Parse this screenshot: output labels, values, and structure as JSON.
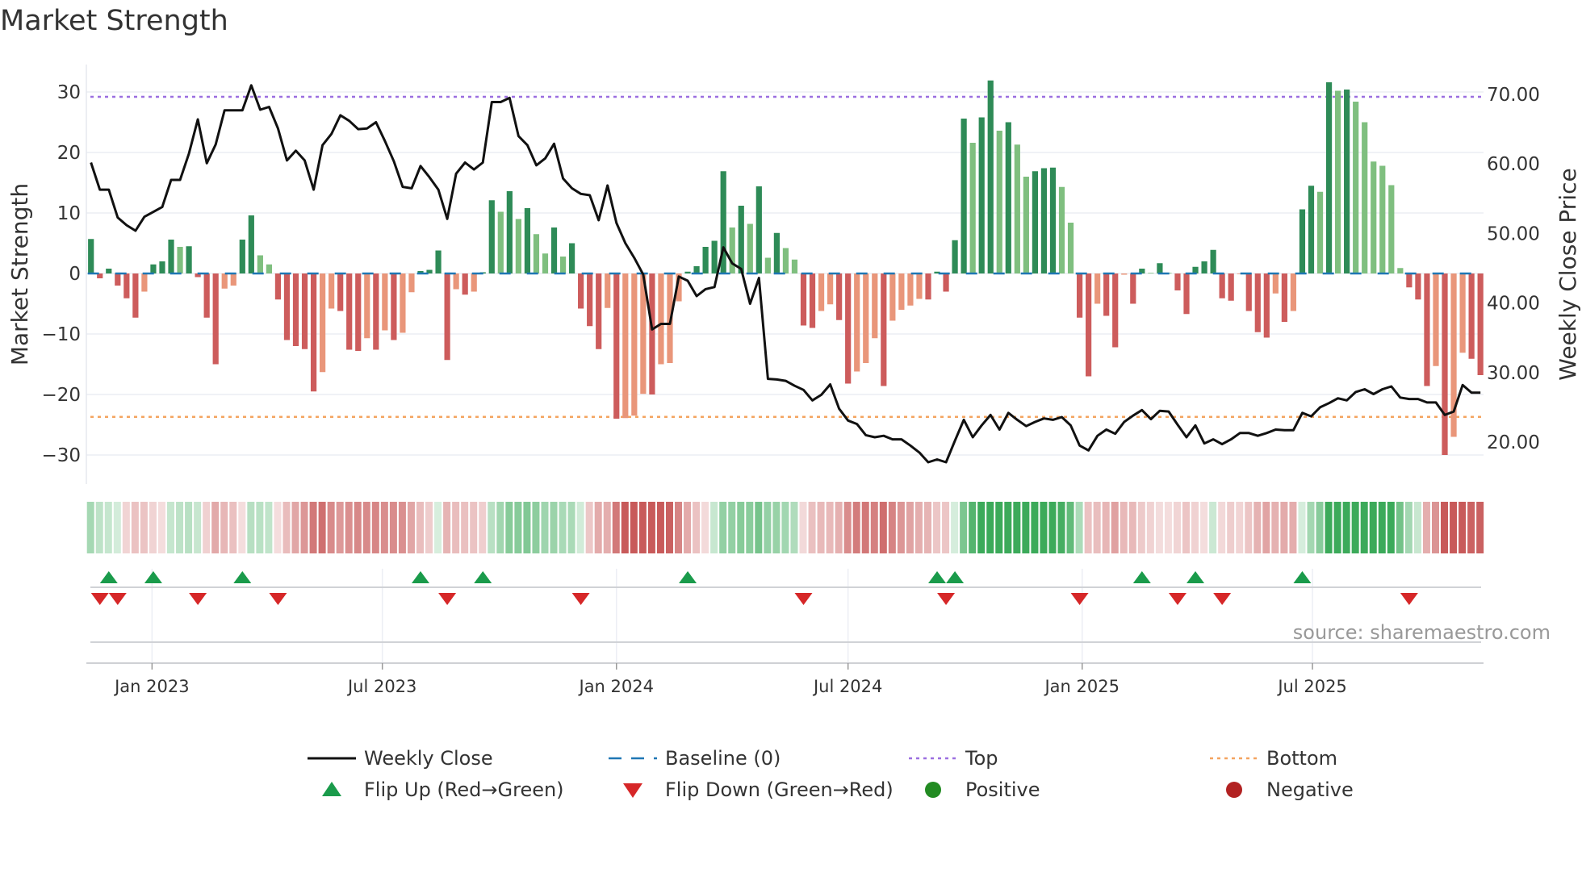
{
  "chart_data": {
    "type": "bar",
    "title": "Market Strength",
    "ylabel": "Market Strength",
    "y2label": "Weekly Close Price",
    "ylim": [
      -33,
      33
    ],
    "y2lim": [
      17,
      74
    ],
    "yticks": [
      30,
      20,
      10,
      0,
      -10,
      -20,
      -30
    ],
    "y2ticks": [
      "70.00",
      "60.00",
      "50.00",
      "40.00",
      "30.00",
      "20.00"
    ],
    "xticks": [
      {
        "label": "Jan 2023",
        "date": "2023-01-01"
      },
      {
        "label": "Jul 2023",
        "date": "2023-07-01"
      },
      {
        "label": "Jan 2024",
        "date": "2024-01-01"
      },
      {
        "label": "Jul 2024",
        "date": "2024-07-01"
      },
      {
        "label": "Jan 2025",
        "date": "2025-01-01"
      },
      {
        "label": "Jul 2025",
        "date": "2025-07-01"
      }
    ],
    "first_week": "2022-11-14",
    "frequency": "weekly",
    "top_level": 29.2,
    "bottom_level": -23.7,
    "strength": [
      5.7,
      -0.8,
      0.8,
      -2,
      -4.1,
      -7.3,
      -3,
      1.5,
      2,
      5.6,
      4.4,
      4.5,
      -0.6,
      -7.3,
      -15,
      -2.5,
      -2,
      5.6,
      9.6,
      3,
      1.5,
      -4.3,
      -11,
      -12,
      -12.5,
      -19.5,
      -16.3,
      -5.8,
      -6.2,
      -12.6,
      -12.8,
      -10.7,
      -12.6,
      -9.4,
      -11,
      -9.8,
      -3.1,
      0.4,
      0.6,
      3.8,
      -14.3,
      -2.6,
      -3.5,
      -3,
      0.2,
      12.1,
      10.2,
      13.6,
      9,
      10.8,
      6.5,
      3.3,
      7.6,
      2.8,
      5,
      -5.8,
      -8.7,
      -12.5,
      -5.7,
      -24,
      -23.9,
      -23.5,
      -19.9,
      -20,
      -15,
      -14.8,
      -4.6,
      0.3,
      1.2,
      4.4,
      5.4,
      16.9,
      7.6,
      11.2,
      8.2,
      14.4,
      2.6,
      6.7,
      4.2,
      2.3,
      -8.6,
      -9,
      -6.2,
      -5.1,
      -7.7,
      -18.2,
      -16.2,
      -14.8,
      -10.7,
      -18.6,
      -7.8,
      -6,
      -5.3,
      -4.2,
      -4.3,
      0.3,
      -3,
      5.5,
      25.6,
      21.6,
      25.8,
      31.9,
      23.6,
      25,
      21.3,
      16,
      16.9,
      17.4,
      17.5,
      14.3,
      8.4,
      -7.3,
      -17,
      -5,
      -7,
      -12.2,
      -0.2,
      -5,
      0.8,
      0.1,
      1.7,
      0.1,
      -2.8,
      -6.7,
      1.1,
      2,
      3.9,
      -4.1,
      -4.5,
      -0.1,
      -6.2,
      -9.7,
      -10.6,
      -3.3,
      -8,
      -6.2,
      10.6,
      14.5,
      13.5,
      31.6,
      30.2,
      30.4,
      28.4,
      25,
      18.5,
      17.8,
      14.6,
      0.9,
      -2.3,
      -4.3,
      -18.6,
      -15.3,
      -30,
      -27,
      -13.1,
      -14.1,
      -16.8
    ],
    "weekly_close": [
      60.2,
      56.3,
      56.3,
      52.3,
      51.2,
      50.4,
      52.4,
      53.1,
      53.8,
      57.7,
      57.7,
      61.5,
      66.4,
      60.1,
      62.8,
      67.7,
      67.7,
      67.7,
      71.3,
      67.8,
      68.2,
      65.1,
      60.5,
      61.9,
      60.5,
      56.3,
      62.7,
      64.3,
      67,
      66.2,
      65,
      65.1,
      66,
      63.3,
      60.4,
      56.7,
      56.5,
      59.7,
      58.1,
      56.3,
      52.1,
      58.6,
      60.2,
      59.2,
      60.2,
      68.9,
      68.9,
      69.5,
      64,
      62.7,
      59.8,
      60.8,
      62.9,
      57.9,
      56.5,
      55.7,
      55.5,
      51.9,
      56.9,
      51.5,
      48.6,
      46.5,
      44.1,
      36.2,
      37,
      37,
      43.8,
      43.2,
      41,
      42,
      42.3,
      48,
      45.7,
      44.9,
      39.9,
      43.6,
      29.1,
      29,
      28.8,
      28.1,
      27.5,
      26,
      26.8,
      28.3,
      24.8,
      23.1,
      22.6,
      21,
      20.7,
      20.9,
      20.4,
      20.4,
      19.5,
      18.5,
      17.1,
      17.5,
      17.1,
      20.2,
      23.2,
      20.7,
      22.4,
      23.9,
      21.8,
      24.2,
      23.2,
      22.3,
      22.9,
      23.4,
      23.2,
      23.6,
      22.4,
      19.5,
      18.8,
      20.9,
      21.8,
      21.2,
      22.9,
      23.8,
      24.6,
      23.3,
      24.5,
      24.4,
      22.5,
      20.7,
      22.4,
      19.8,
      20.4,
      19.7,
      20.4,
      21.3,
      21.3,
      20.9,
      21.3,
      21.8,
      21.7,
      21.7,
      24.2,
      23.7,
      25,
      25.6,
      26.3,
      26,
      27.2,
      27.6,
      26.9,
      27.6,
      28,
      26.4,
      26.2,
      26.2,
      25.7,
      25.7,
      23.9,
      24.4,
      28.2,
      27.1,
      27.1
    ],
    "flip_up_weeks": [
      2,
      7,
      17,
      37,
      44,
      67,
      95,
      97,
      118,
      124,
      136
    ],
    "flip_down_weeks": [
      1,
      3,
      12,
      21,
      40,
      55,
      80,
      96,
      111,
      122,
      127,
      148
    ],
    "legend": {
      "placement": "bottom",
      "items": [
        {
          "label": "Weekly Close",
          "kind": "line"
        },
        {
          "label": "Baseline (0)",
          "kind": "dash"
        },
        {
          "label": "Top",
          "kind": "dot-top"
        },
        {
          "label": "Bottom",
          "kind": "dot-bottom"
        },
        {
          "label": "Flip Up (Red→Green)",
          "kind": "tri-up"
        },
        {
          "label": "Flip Down (Green→Red)",
          "kind": "tri-down"
        },
        {
          "label": "Positive",
          "kind": "circle-pos"
        },
        {
          "label": "Negative",
          "kind": "circle-neg"
        }
      ]
    },
    "source": "source: sharemaestro.com",
    "colors": {
      "green_rising": "#2e8b57",
      "green_falling": "#7fbf7f",
      "red_falling": "#cd5c5c",
      "red_rising": "#e9967a",
      "baseline": "#1f77b4",
      "top": "#9b6fe0",
      "bottom": "#f4a460",
      "close": "#111111",
      "flip_up": "#1a9b4b",
      "flip_down": "#d62728",
      "positive": "#228b22",
      "negative": "#b22222"
    }
  }
}
